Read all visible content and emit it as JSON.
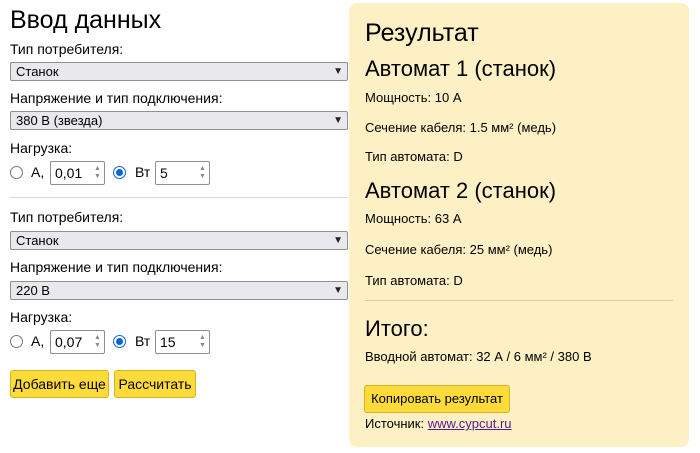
{
  "input": {
    "title": "Ввод данных",
    "blocks": [
      {
        "consumer_label": "Тип потребителя:",
        "consumer_value": "Станок",
        "voltage_label": "Напряжение и тип подключения:",
        "voltage_value": "380 В (звезда)",
        "load_label": "Нагрузка:",
        "unit_a": "А,",
        "a_value": "0,01",
        "unit_w": "Вт",
        "w_value": "5",
        "selected_unit": "Вт"
      },
      {
        "consumer_label": "Тип потребителя:",
        "consumer_value": "Станок",
        "voltage_label": "Напряжение и тип подключения:",
        "voltage_value": "220 В",
        "load_label": "Нагрузка:",
        "unit_a": "А,",
        "a_value": "0,07",
        "unit_w": "Вт",
        "w_value": "15",
        "selected_unit": "Вт"
      }
    ],
    "add_button": "Добавить еще",
    "calc_button": "Рассчитать"
  },
  "result": {
    "title": "Результат",
    "breakers": [
      {
        "heading": "Автомат 1 (станок)",
        "power": "Мощность: 10 А",
        "cable": "Сечение кабеля: 1.5 мм² (медь)",
        "type": "Тип автомата: D"
      },
      {
        "heading": "Автомат 2 (станок)",
        "power": "Мощность: 63 А",
        "cable": "Сечение кабеля: 25 мм² (медь)",
        "type": "Тип автомата: D"
      }
    ],
    "total_title": "Итого:",
    "total_text": "Вводной автомат: 32 А / 6 мм² / 380 В",
    "copy_button": "Копировать результат",
    "source_label": "Источник:",
    "source_link": "www.cypcut.ru"
  },
  "colors": {
    "result_bg": "#fdf0c4",
    "button": "#fddb3a",
    "radio_accent": "#0a64d8",
    "link": "#551a8b"
  }
}
